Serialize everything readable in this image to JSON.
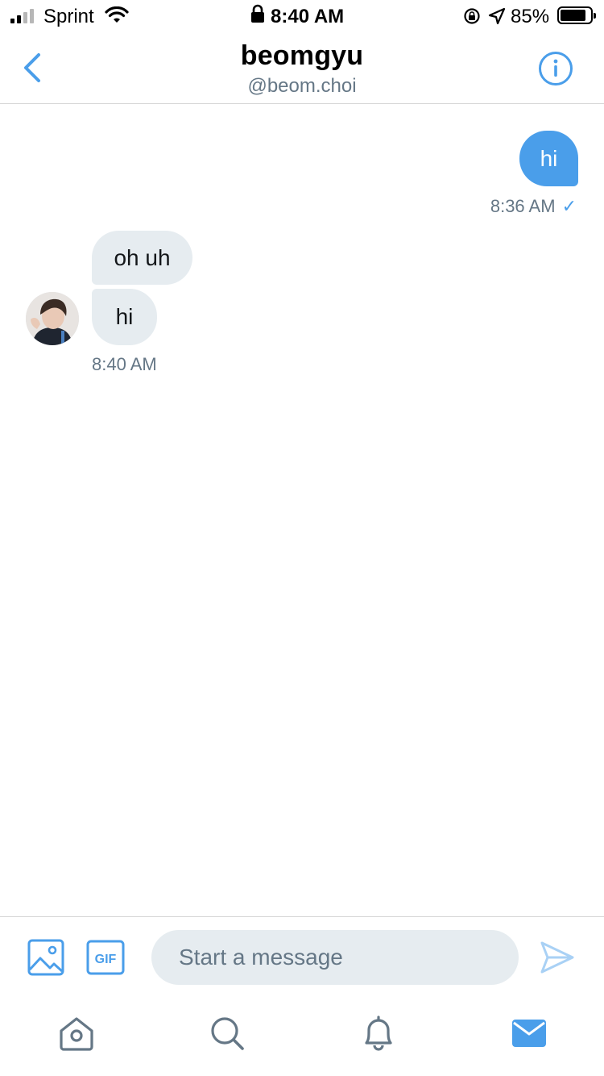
{
  "status_bar": {
    "carrier": "Sprint",
    "time": "8:40 AM",
    "battery_pct": "85%",
    "battery_level": 0.85,
    "signal_bars_filled": 2,
    "signal_bars_total": 4
  },
  "header": {
    "name": "beomgyu",
    "handle": "@beom.choi",
    "back_icon": "chevron-left-icon",
    "info_icon": "info-icon"
  },
  "messages": {
    "outgoing": [
      {
        "text": "hi",
        "time": "8:36 AM",
        "status": "✓"
      }
    ],
    "incoming": [
      {
        "text": "oh uh"
      },
      {
        "text": "hi"
      }
    ],
    "incoming_time": "8:40 AM"
  },
  "composer": {
    "placeholder": "Start a message",
    "gif_label": "GIF",
    "image_icon": "image-icon",
    "send_icon": "send-icon"
  },
  "tabbar": {
    "items": [
      "home-icon",
      "search-icon",
      "bell-icon",
      "mail-icon"
    ],
    "active": "mail-icon"
  },
  "colors": {
    "accent": "#4a9eea",
    "bubble_in": "#e6ecf0",
    "secondary_text": "#657786"
  }
}
